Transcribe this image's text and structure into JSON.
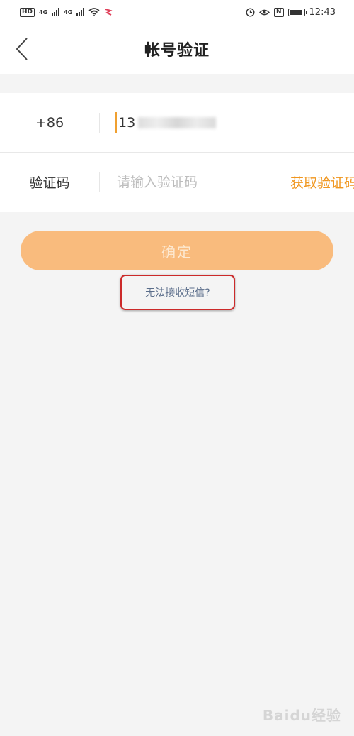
{
  "status_bar": {
    "left_chip": "HD",
    "net1": "4G",
    "net2": "4G",
    "nfc": "N",
    "time": "12:43",
    "battery_level": 0.9
  },
  "nav": {
    "title": "帐号验证"
  },
  "form": {
    "phone_prefix": "+86",
    "phone_value": "13",
    "code_label": "验证码",
    "code_placeholder": "请输入验证码",
    "get_code_label": "获取验证码"
  },
  "actions": {
    "confirm_label": "确定",
    "sms_help_label": "无法接收短信?"
  },
  "watermark": {
    "text": "Baidu经验"
  },
  "colors": {
    "accent": "#f0961e",
    "button_bg": "#f9bb7d",
    "highlight_border": "#cc2a2a",
    "link": "#5a6d8a"
  }
}
